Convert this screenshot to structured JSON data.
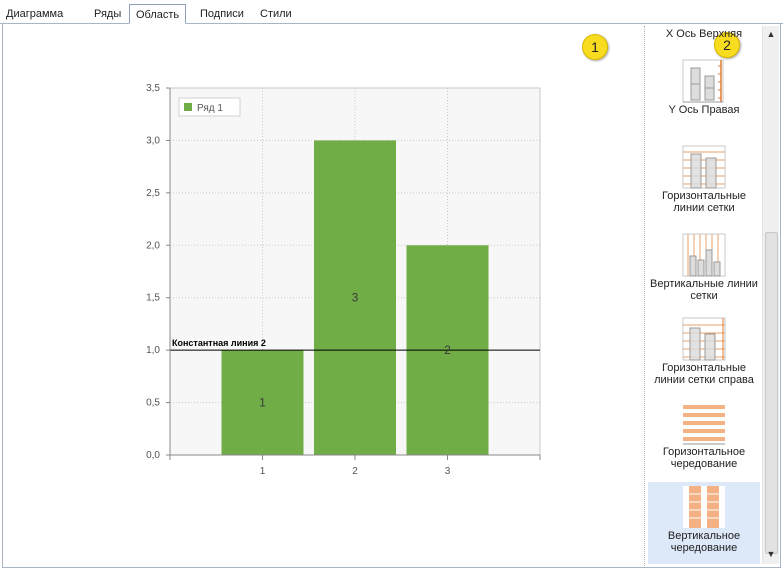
{
  "tabs": [
    "Диаграмма",
    "Ряды",
    "Область",
    "Подписи",
    "Стили"
  ],
  "active_tab": "Область",
  "markers": [
    "1",
    "2"
  ],
  "chart_data": {
    "type": "bar",
    "categories": [
      "1",
      "2",
      "3"
    ],
    "series": [
      {
        "name": "Ряд 1",
        "values": [
          1,
          3,
          2
        ],
        "color": "#70ad47"
      }
    ],
    "data_labels": [
      "1",
      "3",
      "2"
    ],
    "ylim": [
      0,
      3.5
    ],
    "yticks": [
      "0,0",
      "0,5",
      "1,0",
      "1,5",
      "2,0",
      "2,5",
      "3,0",
      "3,5"
    ],
    "constant_line": {
      "label": "Константная линия 2",
      "value": 1.0
    },
    "grid": true,
    "legend_position": "top-left"
  },
  "panel": {
    "options": [
      {
        "label": "X Ось Верхняя",
        "icon": "x-axis-top-icon"
      },
      {
        "label": "Y Ось Правая",
        "icon": "y-axis-right-icon"
      },
      {
        "label": "Горизонтальные линии сетки",
        "icon": "horizontal-gridlines-icon"
      },
      {
        "label": "Вертикальные линии сетки",
        "icon": "vertical-gridlines-icon"
      },
      {
        "label": "Горизонтальные линии сетки справа",
        "icon": "horizontal-gridlines-right-icon"
      },
      {
        "label": "Горизонтальное чередование",
        "icon": "horizontal-interlacing-icon"
      },
      {
        "label": "Вертикальное чередование",
        "icon": "vertical-interlacing-icon"
      }
    ],
    "selected": "Вертикальное чередование"
  },
  "colors": {
    "bar": "#70ad47",
    "accent": "#f0a868",
    "selected_bg": "#dde9f8",
    "marker": "#f7dc1f"
  }
}
